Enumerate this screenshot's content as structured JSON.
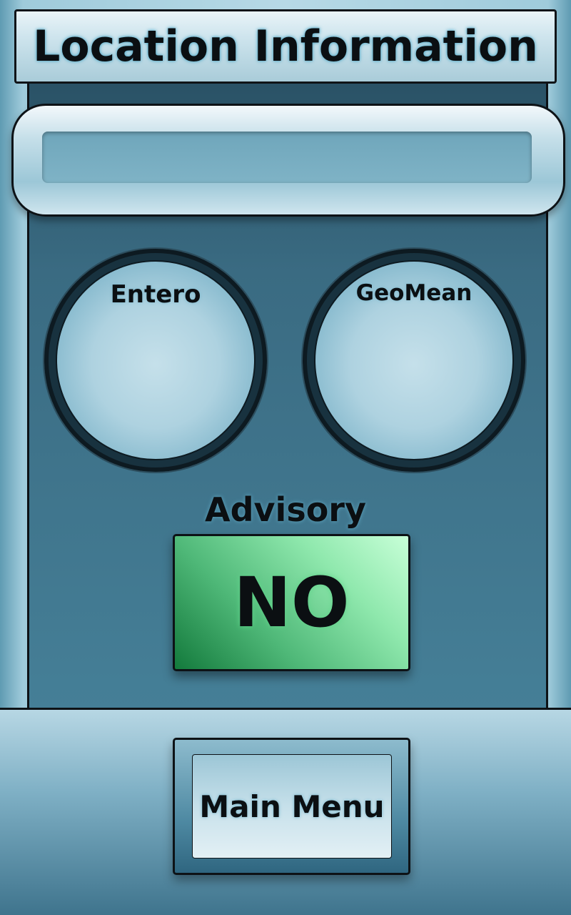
{
  "header": {
    "title": "Location Information"
  },
  "location": {
    "name_value": ""
  },
  "gauges": [
    {
      "label": "Entero",
      "value": ""
    },
    {
      "label": "GeoMean",
      "value": ""
    }
  ],
  "advisory": {
    "label": "Advisory",
    "value": "NO",
    "status_color": "#4fb878"
  },
  "footer": {
    "main_menu_label": "Main Menu"
  },
  "colors": {
    "panel": "#3a6b82",
    "accent": "#b7d9e6",
    "border": "#0d1216"
  }
}
